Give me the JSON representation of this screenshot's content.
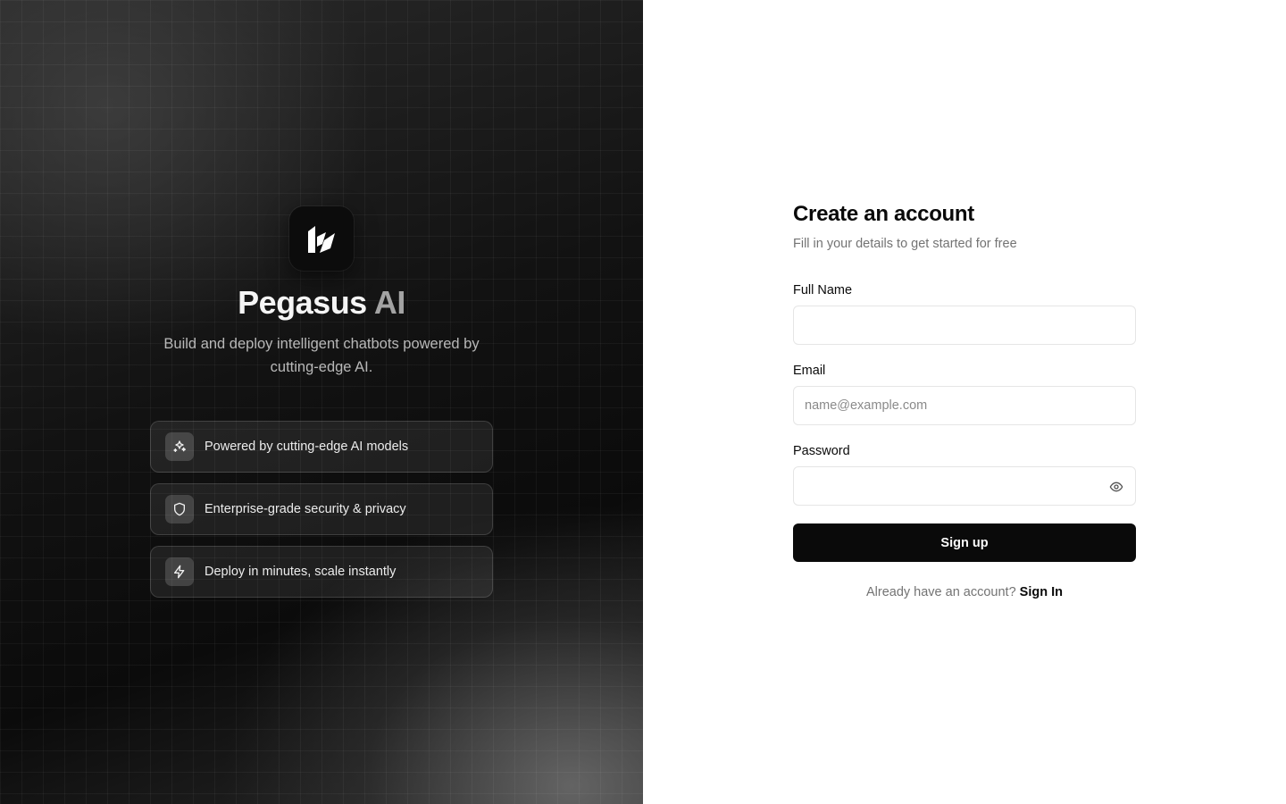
{
  "hero": {
    "brand_name": "Pegasus",
    "brand_accent": "AI",
    "tagline": "Build and deploy intelligent chatbots powered by cutting-edge AI.",
    "logo_icon": "pegasus-logo-icon",
    "features": [
      {
        "icon": "sparkles-icon",
        "label": "Powered by cutting-edge AI models"
      },
      {
        "icon": "shield-icon",
        "label": "Enterprise-grade security & privacy"
      },
      {
        "icon": "lightning-icon",
        "label": "Deploy in minutes, scale instantly"
      }
    ]
  },
  "form": {
    "title": "Create an account",
    "subtitle": "Fill in your details to get started for free",
    "full_name": {
      "label": "Full Name",
      "value": "",
      "placeholder": ""
    },
    "email": {
      "label": "Email",
      "value": "",
      "placeholder": "name@example.com"
    },
    "password": {
      "label": "Password",
      "value": "",
      "placeholder": "",
      "toggle_icon": "eye-icon"
    },
    "submit_label": "Sign up",
    "signin_prompt": "Already have an account?",
    "signin_link": "Sign In"
  },
  "colors": {
    "primary": "#0a0a0a",
    "muted_text": "#737373",
    "border": "#e5e5e5",
    "brand_accent": "#a3a3a3"
  }
}
